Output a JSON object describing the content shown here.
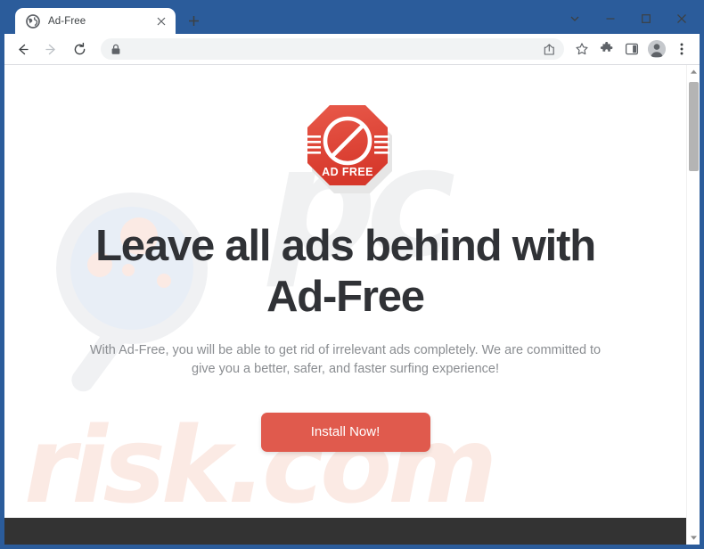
{
  "browser": {
    "frame_color": "#2b5c9b",
    "tab": {
      "title": "Ad-Free",
      "favicon": "globe-icon",
      "close_label": "×"
    },
    "new_tab_label": "+",
    "window_controls": {
      "tab_search_label": "⌄",
      "minimize_label": "–",
      "maximize_label": "□",
      "close_label": "×"
    },
    "toolbar": {
      "back_label": "←",
      "forward_label": "→",
      "reload_label": "↻",
      "address_value": "",
      "address_placeholder": "",
      "lock_icon": "lock-icon",
      "share_icon": "share-icon",
      "bookmark_icon": "star-icon",
      "extensions_icon": "puzzle-icon",
      "sidepanel_icon": "side-panel-icon",
      "profile_icon": "avatar-icon",
      "menu_icon": "three-dot-menu-icon"
    },
    "scrollbar": {
      "up_label": "▲",
      "down_label": "▼"
    }
  },
  "page": {
    "logo": {
      "name": "ad-free-stop-sign-logo",
      "text": "AD FREE",
      "color": "#e0483a"
    },
    "headline": "Leave all ads behind with Ad-Free",
    "subtitle": "With Ad-Free, you will be able to get rid of irrelevant ads completely. We are committed to give you a better, safer, and faster surfing experience!",
    "cta_label": "Install Now!",
    "cta_color": "#e05a4d",
    "watermark_top": "pc",
    "watermark_bottom": "risk.com",
    "headline_color": "#303236",
    "subtitle_color": "#8a8d91",
    "footer_color": "#333333"
  }
}
